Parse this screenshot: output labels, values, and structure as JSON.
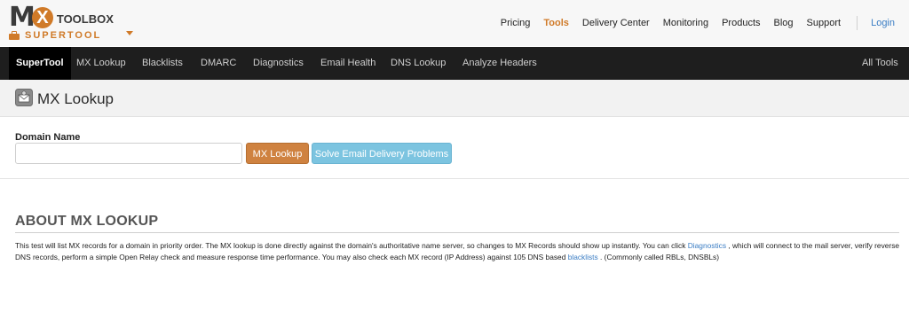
{
  "brand": {
    "logo_mx": "MX",
    "logo_toolbox": "TOOLBOX",
    "product": "SUPERTOOL",
    "accent_color": "#d07a28"
  },
  "topnav": {
    "items": [
      "Pricing",
      "Tools",
      "Delivery Center",
      "Monitoring",
      "Products",
      "Blog",
      "Support"
    ],
    "active": "Tools",
    "login": "Login"
  },
  "darknav": {
    "items": [
      "SuperTool",
      "MX Lookup",
      "Blacklists",
      "DMARC",
      "Diagnostics",
      "Email Health",
      "DNS Lookup",
      "Analyze Headers"
    ],
    "active": "SuperTool",
    "all_tools": "All Tools"
  },
  "page": {
    "title": "MX Lookup",
    "title_icon": "envelope-gear-icon"
  },
  "form": {
    "label": "Domain Name",
    "input_value": "",
    "input_placeholder": "",
    "lookup_button": "MX Lookup",
    "solve_button": "Solve Email Delivery Problems"
  },
  "about": {
    "heading": "ABOUT MX LOOKUP",
    "text_part1": "This test will list MX records for a domain in priority order. The MX lookup is done directly against the domain's authoritative name server, so changes to MX Records should show up instantly. You can click ",
    "link_diagnostics": "Diagnostics",
    "text_part2": " , which will connect to the mail server, verify reverse DNS records, perform a simple Open Relay check and measure response time performance. You may also check each MX record (IP Address) against 105 DNS based ",
    "link_blacklists": "blacklists",
    "text_part3": " . (Commonly called RBLs, DNSBLs)"
  }
}
